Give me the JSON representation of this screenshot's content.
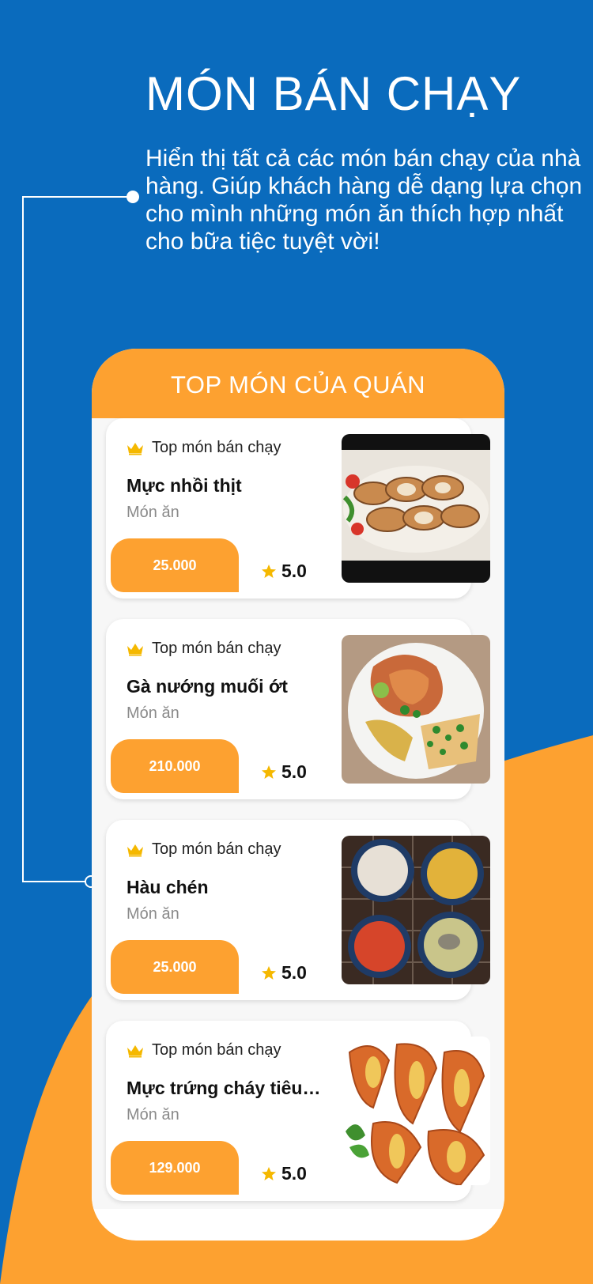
{
  "colors": {
    "background_blue": "#0a6bbd",
    "accent_orange": "#fda130",
    "card_background": "#ffffff",
    "muted_text": "#8a8a8a",
    "star_yellow": "#f5b800"
  },
  "promo": {
    "headline": "MÓN BÁN CHẠY",
    "description": "Hiển thị tất cả các món bán chạy của nhà hàng. Giúp khách hàng dễ dạng lựa chọn cho mình những món ăn thích hợp nhất cho bữa tiệc tuyệt vời!"
  },
  "screen": {
    "title": "TOP MÓN CỦA QUÁN",
    "items": [
      {
        "badge": "Top món bán chạy",
        "badge_icon": "crown-icon",
        "name": "Mực nhồi thịt",
        "category": "Món ăn",
        "price": "25.000",
        "rating": "5.0",
        "rating_icon": "star-icon",
        "image": "stuffed-squid-photo"
      },
      {
        "badge": "Top món bán chạy",
        "badge_icon": "crown-icon",
        "name": "Gà nướng muối ớt",
        "category": "Món ăn",
        "price": "210.000",
        "rating": "5.0",
        "rating_icon": "star-icon",
        "image": "grilled-chicken-photo"
      },
      {
        "badge": "Top món bán chạy",
        "badge_icon": "crown-icon",
        "name": "Hàu chén",
        "category": "Món ăn",
        "price": "25.000",
        "rating": "5.0",
        "rating_icon": "star-icon",
        "image": "oysters-in-bowls-photo"
      },
      {
        "badge": "Top món bán chạy",
        "badge_icon": "crown-icon",
        "name": "Mực trứng cháy tiêu xanh",
        "category": "Món ăn",
        "price": "129.000",
        "rating": "5.0",
        "rating_icon": "star-icon",
        "image": "squid-eggs-photo"
      }
    ]
  }
}
